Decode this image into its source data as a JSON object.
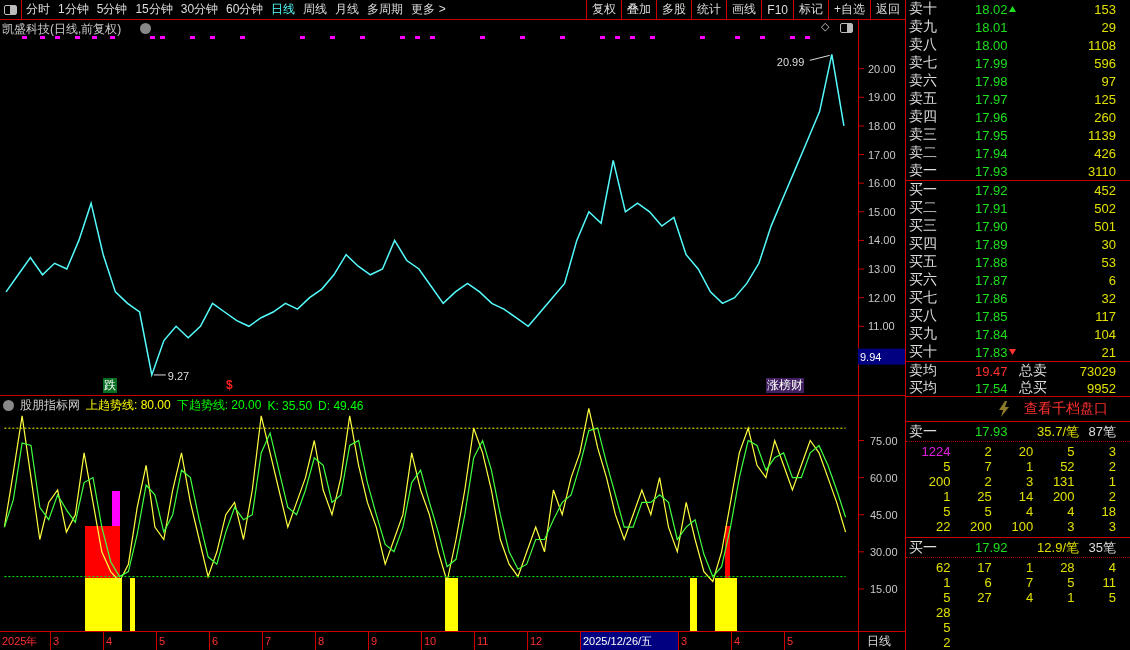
{
  "toolbar": {
    "periods": [
      {
        "label": "分时",
        "selected": false
      },
      {
        "label": "1分钟",
        "selected": false
      },
      {
        "label": "5分钟",
        "selected": false
      },
      {
        "label": "15分钟",
        "selected": false
      },
      {
        "label": "30分钟",
        "selected": false
      },
      {
        "label": "60分钟",
        "selected": false
      },
      {
        "label": "日线",
        "selected": true
      },
      {
        "label": "周线",
        "selected": false
      },
      {
        "label": "月线",
        "selected": false
      },
      {
        "label": "多周期",
        "selected": false
      },
      {
        "label": "更多 >",
        "selected": false
      }
    ],
    "buttons": [
      "复权",
      "叠加",
      "多股",
      "统计",
      "画线",
      "F10",
      "标记",
      "+自选",
      "返回"
    ]
  },
  "main_chart": {
    "title": "凯盛科技(日线,前复权)",
    "corner_mark": "◇",
    "cursor_price": "9.94",
    "markers": [
      {
        "text": "跌",
        "kind": "fall"
      },
      {
        "text": "$",
        "kind": "dollar"
      },
      {
        "text": "涨榜财",
        "kind": "tag"
      }
    ],
    "chart_data": {
      "type": "line",
      "ylim": [
        8.6,
        21.7
      ],
      "yticks": [
        {
          "value": 11,
          "label": "11.00"
        },
        {
          "value": 12,
          "label": "12.00"
        },
        {
          "value": 13,
          "label": "13.00"
        },
        {
          "value": 14,
          "label": "14.00"
        },
        {
          "value": 15,
          "label": "15.00"
        },
        {
          "value": 16,
          "label": "16.00"
        },
        {
          "value": 17,
          "label": "17.00"
        },
        {
          "value": 18,
          "label": "18.00"
        },
        {
          "value": 19,
          "label": "19.00"
        },
        {
          "value": 20,
          "label": "20.00"
        }
      ],
      "series": [
        {
          "color": "#54fcfc",
          "values": [
            12.2,
            12.8,
            13.4,
            12.8,
            13.2,
            13.0,
            14.0,
            15.3,
            13.5,
            12.2,
            11.8,
            11.5,
            9.3,
            10.5,
            11.0,
            10.6,
            11.0,
            11.8,
            11.5,
            11.2,
            11.0,
            11.3,
            11.5,
            11.8,
            11.6,
            12.0,
            12.3,
            12.8,
            13.5,
            13.1,
            12.8,
            13.0,
            14.0,
            13.3,
            13.0,
            12.4,
            11.8,
            12.2,
            12.5,
            12.2,
            11.8,
            11.6,
            11.3,
            11.0,
            11.5,
            12.0,
            12.5,
            14.0,
            15.0,
            14.6,
            16.8,
            15.0,
            15.3,
            15.0,
            14.5,
            14.8,
            13.5,
            13.0,
            12.2,
            11.8,
            12.0,
            12.5,
            13.2,
            14.5,
            15.5,
            16.5,
            17.5,
            18.5,
            20.5,
            18.0
          ]
        }
      ],
      "annotations": [
        "20.99",
        "9.27"
      ]
    }
  },
  "indicator": {
    "name": "股朋指标网",
    "items": [
      {
        "label": "上趋势线: 80.00",
        "color": "#ffff00"
      },
      {
        "label": "下趋势线: 20.00",
        "color": "#00ff00"
      },
      {
        "label": "K: 35.50",
        "color": "#00ff00"
      },
      {
        "label": "D: 49.46",
        "color": "#00ff00"
      }
    ],
    "chart_data": {
      "type": "line",
      "ylim": [
        -2,
        93
      ],
      "yticks": [
        {
          "value": 15,
          "label": "15.00"
        },
        {
          "value": 30,
          "label": "30.00"
        },
        {
          "value": 45,
          "label": "45.00"
        },
        {
          "value": 60,
          "label": "60.00"
        },
        {
          "value": 75,
          "label": "75.00"
        }
      ],
      "series": [
        {
          "color": "#ffff40",
          "values": [
            40,
            62,
            85,
            60,
            35,
            50,
            55,
            38,
            45,
            70,
            50,
            30,
            22,
            18,
            25,
            48,
            65,
            40,
            35,
            55,
            70,
            50,
            35,
            20,
            30,
            45,
            50,
            35,
            55,
            85,
            70,
            55,
            40,
            50,
            60,
            75,
            55,
            45,
            60,
            85,
            65,
            50,
            40,
            25,
            35,
            45,
            70,
            55,
            45,
            30,
            18,
            35,
            55,
            80,
            70,
            55,
            35,
            25,
            20,
            30,
            40,
            30,
            55,
            45,
            60,
            70,
            88,
            72,
            60,
            45,
            35,
            45,
            55,
            45,
            60,
            40,
            30,
            50,
            35,
            22,
            18,
            30,
            50,
            70,
            80,
            65,
            60,
            75,
            65,
            55,
            65,
            75,
            70,
            60,
            50,
            38
          ]
        },
        {
          "color": "#40ff40",
          "values": [
            40,
            51,
            74,
            73,
            48,
            43,
            53,
            47,
            42,
            58,
            60,
            40,
            26,
            20,
            22,
            37,
            57,
            53,
            38,
            45,
            63,
            60,
            43,
            28,
            25,
            38,
            48,
            43,
            45,
            70,
            78,
            63,
            48,
            45,
            55,
            68,
            65,
            50,
            53,
            73,
            75,
            58,
            45,
            33,
            30,
            40,
            58,
            63,
            50,
            38,
            24,
            27,
            45,
            68,
            75,
            63,
            45,
            30,
            23,
            25,
            35,
            35,
            43,
            50,
            53,
            65,
            79,
            80,
            66,
            53,
            40,
            40,
            50,
            50,
            53,
            50,
            35,
            40,
            43,
            29,
            20,
            24,
            40,
            60,
            75,
            73,
            63,
            68,
            70,
            60,
            60,
            70,
            73,
            65,
            55,
            44
          ]
        },
        {
          "color": "#ffff00",
          "line_style": "dashed",
          "values": [
            80,
            80,
            80,
            80,
            80,
            80,
            80,
            80,
            80,
            80,
            80,
            80,
            80,
            80,
            80,
            80,
            80,
            80,
            80,
            80,
            80,
            80,
            80,
            80,
            80,
            80,
            80,
            80,
            80,
            80,
            80,
            80,
            80,
            80,
            80,
            80,
            80,
            80,
            80,
            80,
            80,
            80,
            80,
            80,
            80,
            80,
            80,
            80,
            80,
            80,
            80,
            80,
            80,
            80,
            80,
            80,
            80,
            80,
            80,
            80,
            80,
            80,
            80,
            80,
            80,
            80,
            80,
            80,
            80,
            80,
            80,
            80,
            80,
            80,
            80,
            80,
            80,
            80,
            80,
            80,
            80,
            80,
            80,
            80,
            80,
            80,
            80,
            80,
            80,
            80,
            80,
            80,
            80,
            80,
            80,
            80
          ]
        },
        {
          "color": "#00ff00",
          "line_style": "dashed",
          "values": [
            20,
            20,
            20,
            20,
            20,
            20,
            20,
            20,
            20,
            20,
            20,
            20,
            20,
            20,
            20,
            20,
            20,
            20,
            20,
            20,
            20,
            20,
            20,
            20,
            20,
            20,
            20,
            20,
            20,
            20,
            20,
            20,
            20,
            20,
            20,
            20,
            20,
            20,
            20,
            20,
            20,
            20,
            20,
            20,
            20,
            20,
            20,
            20,
            20,
            20,
            20,
            20,
            20,
            20,
            20,
            20,
            20,
            20,
            20,
            20,
            20,
            20,
            20,
            20,
            20,
            20,
            20,
            20,
            20,
            20,
            20,
            20,
            20,
            20,
            20,
            20,
            20,
            20,
            20,
            20,
            20,
            20,
            20,
            20,
            20,
            20,
            20,
            20,
            20,
            20,
            20,
            20,
            20,
            20,
            20,
            20
          ]
        }
      ]
    }
  },
  "time_axis": {
    "labels": [
      {
        "text": "2025年",
        "selected": false
      },
      {
        "text": "3",
        "selected": false
      },
      {
        "text": "4",
        "selected": false
      },
      {
        "text": "5",
        "selected": false
      },
      {
        "text": "6",
        "selected": false
      },
      {
        "text": "7",
        "selected": false
      },
      {
        "text": "8",
        "selected": false
      },
      {
        "text": "9",
        "selected": false
      },
      {
        "text": "10",
        "selected": false
      },
      {
        "text": "11",
        "selected": false
      },
      {
        "text": "12",
        "selected": false
      },
      {
        "text": "2025/12/26/五",
        "selected": true
      },
      {
        "text": "3",
        "selected": false
      },
      {
        "text": "4",
        "selected": false
      },
      {
        "text": "5",
        "selected": false
      }
    ],
    "period": "日线"
  },
  "order_book": {
    "asks": [
      {
        "label": "卖十",
        "price": "18.02",
        "volume": "153",
        "kind": "up-arrow"
      },
      {
        "label": "卖九",
        "price": "18.01",
        "volume": "29",
        "kind": "plain"
      },
      {
        "label": "卖八",
        "price": "18.00",
        "volume": "1108",
        "kind": "plain"
      },
      {
        "label": "卖七",
        "price": "17.99",
        "volume": "596",
        "kind": "plain"
      },
      {
        "label": "卖六",
        "price": "17.98",
        "volume": "97",
        "kind": "plain"
      },
      {
        "label": "卖五",
        "price": "17.97",
        "volume": "125",
        "kind": "plain"
      },
      {
        "label": "卖四",
        "price": "17.96",
        "volume": "260",
        "kind": "plain"
      },
      {
        "label": "卖三",
        "price": "17.95",
        "volume": "1139",
        "kind": "plain"
      },
      {
        "label": "卖二",
        "price": "17.94",
        "volume": "426",
        "kind": "plain"
      },
      {
        "label": "卖一",
        "price": "17.93",
        "volume": "3110",
        "kind": "plain"
      }
    ],
    "bids": [
      {
        "label": "买一",
        "price": "17.92",
        "volume": "452",
        "kind": "plain"
      },
      {
        "label": "买二",
        "price": "17.91",
        "volume": "502",
        "kind": "plain"
      },
      {
        "label": "买三",
        "price": "17.90",
        "volume": "501",
        "kind": "plain"
      },
      {
        "label": "买四",
        "price": "17.89",
        "volume": "30",
        "kind": "plain"
      },
      {
        "label": "买五",
        "price": "17.88",
        "volume": "53",
        "kind": "plain"
      },
      {
        "label": "买六",
        "price": "17.87",
        "volume": "6",
        "kind": "plain"
      },
      {
        "label": "买七",
        "price": "17.86",
        "volume": "32",
        "kind": "plain"
      },
      {
        "label": "买八",
        "price": "17.85",
        "volume": "117",
        "kind": "plain"
      },
      {
        "label": "买九",
        "price": "17.84",
        "volume": "104",
        "kind": "plain"
      },
      {
        "label": "买十",
        "price": "17.83",
        "volume": "21",
        "kind": "down-arrow"
      }
    ],
    "summary": [
      {
        "label": "卖均",
        "price": "19.47",
        "up": true,
        "total_label": "总卖",
        "total": "73029"
      },
      {
        "label": "买均",
        "price": "17.54",
        "up": false,
        "total_label": "总买",
        "total": "9952"
      }
    ],
    "link": "查看千档盘口"
  },
  "queues": [
    {
      "label": "卖一",
      "price": "17.93",
      "avg": "35.7/笔",
      "count": "87笔",
      "rows": [
        [
          {
            "v": "1224",
            "large": true
          },
          {
            "v": "2",
            "large": false
          },
          {
            "v": "20",
            "large": false
          },
          {
            "v": "5",
            "large": false
          },
          {
            "v": "3",
            "large": false
          }
        ],
        [
          {
            "v": "5",
            "large": false
          },
          {
            "v": "7",
            "large": false
          },
          {
            "v": "1",
            "large": false
          },
          {
            "v": "52",
            "large": false
          },
          {
            "v": "2",
            "large": false
          }
        ],
        [
          {
            "v": "200",
            "large": false
          },
          {
            "v": "2",
            "large": false
          },
          {
            "v": "3",
            "large": false
          },
          {
            "v": "131",
            "large": false
          },
          {
            "v": "1",
            "large": false
          }
        ],
        [
          {
            "v": "1",
            "large": false
          },
          {
            "v": "25",
            "large": false
          },
          {
            "v": "14",
            "large": false
          },
          {
            "v": "200",
            "large": false
          },
          {
            "v": "2",
            "large": false
          }
        ],
        [
          {
            "v": "5",
            "large": false
          },
          {
            "v": "5",
            "large": false
          },
          {
            "v": "4",
            "large": false
          },
          {
            "v": "4",
            "large": false
          },
          {
            "v": "18",
            "large": false
          }
        ],
        [
          {
            "v": "22",
            "large": false
          },
          {
            "v": "200",
            "large": false
          },
          {
            "v": "100",
            "large": false
          },
          {
            "v": "3",
            "large": false
          },
          {
            "v": "3",
            "large": false
          }
        ]
      ]
    },
    {
      "label": "买一",
      "price": "17.92",
      "avg": "12.9/笔",
      "count": "35笔",
      "rows": [
        [
          {
            "v": "62",
            "large": false
          },
          {
            "v": "17",
            "large": false
          },
          {
            "v": "1",
            "large": false
          },
          {
            "v": "28",
            "large": false
          },
          {
            "v": "4",
            "large": false
          }
        ],
        [
          {
            "v": "1",
            "large": false
          },
          {
            "v": "6",
            "large": false
          },
          {
            "v": "7",
            "large": false
          },
          {
            "v": "5",
            "large": false
          },
          {
            "v": "11",
            "large": false
          }
        ],
        [
          {
            "v": "5",
            "large": false
          },
          {
            "v": "27",
            "large": false
          },
          {
            "v": "4",
            "large": false
          },
          {
            "v": "1",
            "large": false
          },
          {
            "v": "5",
            "large": false
          }
        ],
        [
          {
            "v": "28",
            "large": false
          }
        ],
        [
          {
            "v": "5",
            "large": false
          }
        ],
        [
          {
            "v": "2",
            "large": false
          }
        ]
      ]
    }
  ]
}
